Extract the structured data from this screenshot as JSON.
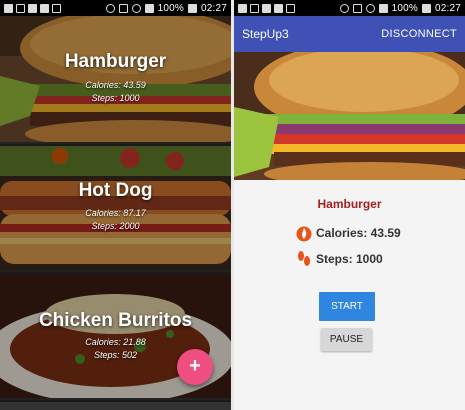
{
  "left_screen": {
    "status_bar": {
      "battery": "100%",
      "time": "02:27"
    },
    "foods": [
      {
        "name": "Hamburger",
        "calories": "Calories: 43.59",
        "steps": "Steps: 1000"
      },
      {
        "name": "Hot Dog",
        "calories": "Calories: 87.17",
        "steps": "Steps: 2000"
      },
      {
        "name": "Chicken Burritos",
        "calories": "Calories: 21.88",
        "steps": "Steps: 502"
      }
    ],
    "fab": {
      "label": "+",
      "color": "#ef4f80",
      "icon": "plus-icon"
    }
  },
  "right_screen": {
    "status_bar": {
      "battery": "100%",
      "time": "02:27"
    },
    "app_bar": {
      "title": "StepUp3",
      "action": "DISCONNECT",
      "color": "#3f51b5"
    },
    "detail": {
      "title": "Hamburger",
      "calories_label": "Calories: 43.59",
      "steps_label": "Steps: 1000",
      "calories_icon": "flame-icon",
      "steps_icon": "footprints-icon"
    },
    "buttons": {
      "start": "START",
      "pause": "PAUSE"
    }
  }
}
